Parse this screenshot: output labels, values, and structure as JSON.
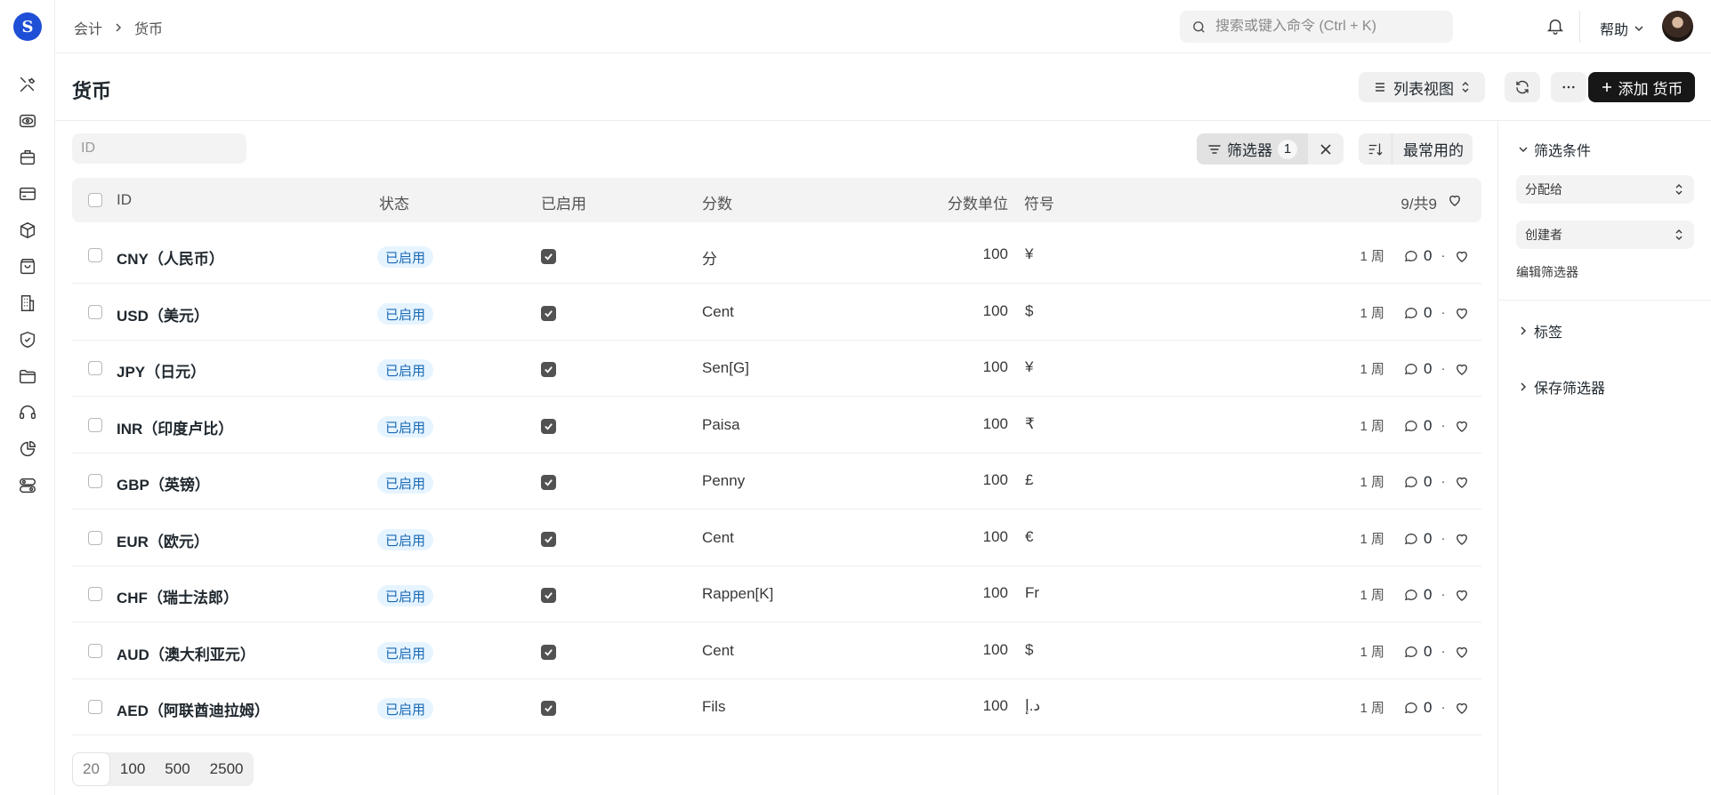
{
  "app": {
    "logo_letter": "S"
  },
  "breadcrumb": [
    "会计",
    "货币"
  ],
  "search": {
    "placeholder": "搜索或键入命令 (Ctrl + K)"
  },
  "topbar": {
    "help_label": "帮助"
  },
  "page": {
    "title": "货币",
    "view_label": "列表视图",
    "add_label": "添加 货币"
  },
  "filters": {
    "id_placeholder": "ID",
    "filter_label": "筛选器",
    "filter_count": "1",
    "sort_label": "最常用的"
  },
  "table": {
    "headers": {
      "id": "ID",
      "status": "状态",
      "enabled": "已启用",
      "fraction": "分数",
      "fraction_units": "分数单位",
      "symbol": "符号",
      "count": "9/共9"
    },
    "rows": [
      {
        "id": "CNY（人民币）",
        "status": "已启用",
        "enabled": true,
        "fraction": "分",
        "fraction_units": "100",
        "symbol": "¥",
        "modified": "1 周",
        "comments": "0"
      },
      {
        "id": "USD（美元）",
        "status": "已启用",
        "enabled": true,
        "fraction": "Cent",
        "fraction_units": "100",
        "symbol": "$",
        "modified": "1 周",
        "comments": "0"
      },
      {
        "id": "JPY（日元）",
        "status": "已启用",
        "enabled": true,
        "fraction": "Sen[G]",
        "fraction_units": "100",
        "symbol": "¥",
        "modified": "1 周",
        "comments": "0"
      },
      {
        "id": "INR（印度卢比）",
        "status": "已启用",
        "enabled": true,
        "fraction": "Paisa",
        "fraction_units": "100",
        "symbol": "₹",
        "modified": "1 周",
        "comments": "0"
      },
      {
        "id": "GBP（英镑）",
        "status": "已启用",
        "enabled": true,
        "fraction": "Penny",
        "fraction_units": "100",
        "symbol": "£",
        "modified": "1 周",
        "comments": "0"
      },
      {
        "id": "EUR（欧元）",
        "status": "已启用",
        "enabled": true,
        "fraction": "Cent",
        "fraction_units": "100",
        "symbol": "€",
        "modified": "1 周",
        "comments": "0"
      },
      {
        "id": "CHF（瑞士法郎）",
        "status": "已启用",
        "enabled": true,
        "fraction": "Rappen[K]",
        "fraction_units": "100",
        "symbol": "Fr",
        "modified": "1 周",
        "comments": "0"
      },
      {
        "id": "AUD（澳大利亚元）",
        "status": "已启用",
        "enabled": true,
        "fraction": "Cent",
        "fraction_units": "100",
        "symbol": "$",
        "modified": "1 周",
        "comments": "0"
      },
      {
        "id": "AED（阿联酋迪拉姆）",
        "status": "已启用",
        "enabled": true,
        "fraction": "Fils",
        "fraction_units": "100",
        "symbol": "د.إ",
        "modified": "1 周",
        "comments": "0"
      }
    ]
  },
  "pager": {
    "options": [
      "20",
      "100",
      "500",
      "2500"
    ],
    "selected": "20"
  },
  "sidebar": {
    "filter_conditions": "筛选条件",
    "assigned_to": "分配给",
    "created_by": "创建者",
    "edit_filters": "编辑筛选器",
    "tags": "标签",
    "saved_filters": "保存筛选器"
  },
  "colors": {
    "accent": "#171717",
    "badge_bg": "#e6f4ff",
    "badge_text": "#1869b5",
    "logo": "#1f4fd6"
  },
  "rail_icons": [
    "tools-icon",
    "eye-icon",
    "briefcase-icon",
    "card-icon",
    "package-icon",
    "shopping-bag-icon",
    "building-icon",
    "shield-icon",
    "folder-icon",
    "headset-icon",
    "pie-chart-icon",
    "toggles-icon"
  ]
}
